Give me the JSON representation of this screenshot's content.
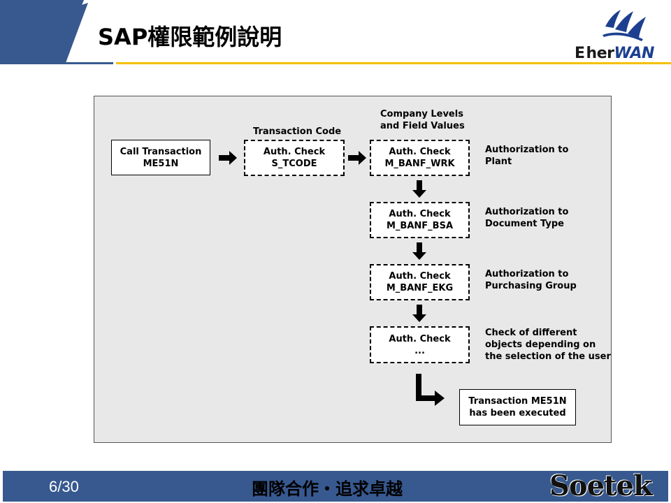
{
  "header": {
    "title": "SAP權限範例說明",
    "logo": {
      "text_prefix": "E",
      "text_mid": "her",
      "text_suffix": "WAN"
    }
  },
  "diagram": {
    "start_box": {
      "line1": "Call Transaction",
      "line2": "ME51N"
    },
    "tcode_label": "Transaction Code",
    "tcode_box": {
      "line1": "Auth. Check",
      "line2": "S_TCODE"
    },
    "company_label": {
      "line1": "Company Levels",
      "line2": "and Field Values"
    },
    "checks": [
      {
        "line1": "Auth. Check",
        "line2": "M_BANF_WRK",
        "desc": [
          "Authorization to",
          "Plant"
        ]
      },
      {
        "line1": "Auth. Check",
        "line2": "M_BANF_BSA",
        "desc": [
          "Authorization to",
          "Document Type"
        ]
      },
      {
        "line1": "Auth. Check",
        "line2": "M_BANF_EKG",
        "desc": [
          "Authorization to",
          "Purchasing Group"
        ]
      },
      {
        "line1": "Auth. Check",
        "line2": "...",
        "desc": [
          "Check of different",
          "objects depending on",
          "the selection of the user"
        ]
      }
    ],
    "result_box": {
      "line1": "Transaction ME51N",
      "line2": "has been executed"
    }
  },
  "footer": {
    "page": "6/30",
    "slogan": "團隊合作‧追求卓越",
    "brand": "Soetek"
  },
  "colors": {
    "header_blue": "#37598f",
    "accent_yellow": "#f5c000",
    "panel_bg": "#e8e8e8"
  }
}
